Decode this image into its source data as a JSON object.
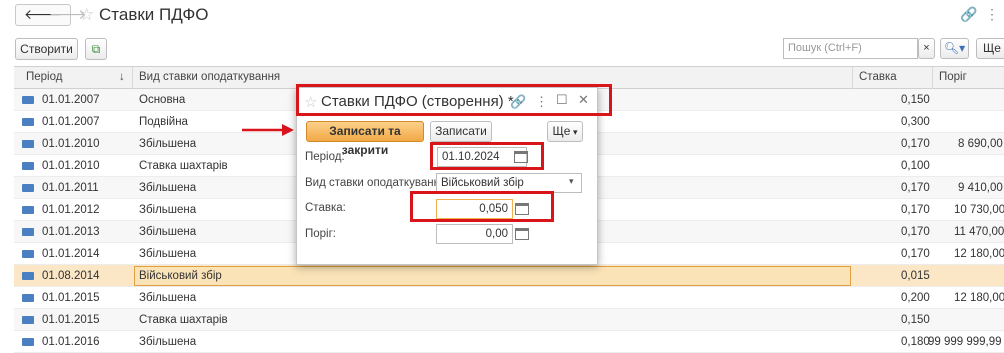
{
  "window": {
    "title": "Ставки ПДФО"
  },
  "toolbar": {
    "create_label": "Створити",
    "search_placeholder": "Пошук (Ctrl+F)",
    "more_label": "Ще"
  },
  "grid": {
    "columns": [
      "Період",
      "Вид ставки оподаткування",
      "Ставка",
      "Поріг"
    ],
    "rows": [
      {
        "period": "01.01.2007",
        "kind": "Основна",
        "rate": "0,150",
        "threshold": ""
      },
      {
        "period": "01.01.2007",
        "kind": "Подвійна",
        "rate": "0,300",
        "threshold": ""
      },
      {
        "period": "01.01.2010",
        "kind": "Збільшена",
        "rate": "0,170",
        "threshold": "8 690,00"
      },
      {
        "period": "01.01.2010",
        "kind": "Ставка шахтарів",
        "rate": "0,100",
        "threshold": ""
      },
      {
        "period": "01.01.2011",
        "kind": "Збільшена",
        "rate": "0,170",
        "threshold": "9 410,00"
      },
      {
        "period": "01.01.2012",
        "kind": "Збільшена",
        "rate": "0,170",
        "threshold": "10 730,00"
      },
      {
        "period": "01.01.2013",
        "kind": "Збільшена",
        "rate": "0,170",
        "threshold": "11 470,00"
      },
      {
        "period": "01.01.2014",
        "kind": "Збільшена",
        "rate": "0,170",
        "threshold": "12 180,00"
      },
      {
        "period": "01.08.2014",
        "kind": "Військовий збір",
        "rate": "0,015",
        "threshold": ""
      },
      {
        "period": "01.01.2015",
        "kind": "Збільшена",
        "rate": "0,200",
        "threshold": "12 180,00"
      },
      {
        "period": "01.01.2015",
        "kind": "Ставка шахтарів",
        "rate": "0,150",
        "threshold": ""
      },
      {
        "period": "01.01.2016",
        "kind": "Збільшена",
        "rate": "0,180",
        "threshold": "99 999 999,99"
      }
    ]
  },
  "dialog": {
    "title": "Ставки ПДФО (створення) *",
    "save_close_label": "Записати та закрити",
    "save_label": "Записати",
    "more_label": "Ще",
    "period_label": "Період:",
    "period_value": "01.10.2024",
    "kind_label": "Вид ставки оподаткування:",
    "kind_value": "Військовий збір",
    "rate_label": "Ставка:",
    "rate_value": "0,050",
    "threshold_label": "Поріг:",
    "threshold_value": "0,00"
  },
  "colors": {
    "accent": "#f5b04f",
    "highlight": "#d9141b",
    "selected_row": "#fbe6c5"
  }
}
